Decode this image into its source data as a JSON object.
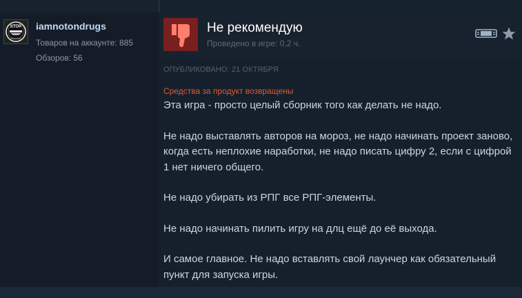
{
  "author": {
    "name": "iamnotondrugs",
    "products_label": "Товаров на аккаунте: 885",
    "reviews_label": "Обзоров: 56",
    "avatar_text_top": "STOP",
    "avatar_text_bottom": "WALKING"
  },
  "review": {
    "verdict": "Не рекомендую",
    "hours": "Проведено в игре: 0,2 ч.",
    "posted": "ОПУБЛИКОВАНО: 21 ОКТЯБРЯ",
    "refunded": "Средства за продукт возвращены",
    "paragraphs": [
      "Эта игра - просто целый сборник того как делать не надо.",
      "Не надо выставлять авторов на мороз, не надо начинать проект заново, когда есть неплохие наработки, не надо писать цифру 2, если с цифрой 1 нет ничего общего.",
      "Не надо убирать из РПГ все РПГ-элементы.",
      "Не надо начинать пилить игру на длц ещё до её выхода.",
      "И самое главное. Не надо вставлять свой лаунчер как обязательный пункт для запуска игры."
    ]
  },
  "icons": {
    "thumb": "thumbs-down-icon",
    "device": "steam-deck-icon",
    "favorite": "star-icon"
  },
  "colors": {
    "background": "#1b2838",
    "thumb_bg": "#7a1f1f",
    "thumb_fg": "#ff7e6e",
    "author_name": "#c1dbf4",
    "refunded": "#e05a33",
    "body_text": "#ced5dc"
  }
}
